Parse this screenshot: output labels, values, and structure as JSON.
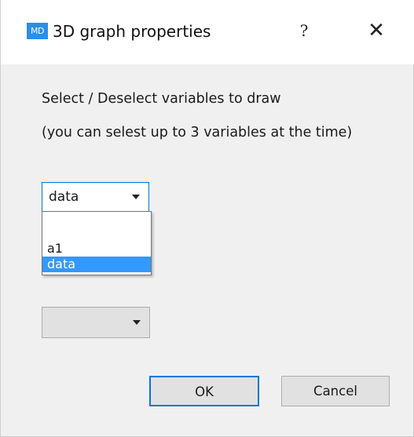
{
  "dialog": {
    "icon_text": "MD",
    "title": "3D graph properties",
    "help_label": "?",
    "close_label": "✕"
  },
  "instructions": {
    "line1": "Select / Deselect variables to draw",
    "line2": "(you can selest up to 3 variables at the time)"
  },
  "variable_select_1": {
    "value": "data",
    "options": [
      "",
      "a1",
      "data"
    ],
    "selected_option": "data"
  },
  "variable_select_2": {
    "value": ""
  },
  "buttons": {
    "ok": "OK",
    "cancel": "Cancel"
  },
  "colors": {
    "accent": "#0078d7",
    "selection": "#3399ff",
    "icon_bg": "#2b8ee8"
  }
}
